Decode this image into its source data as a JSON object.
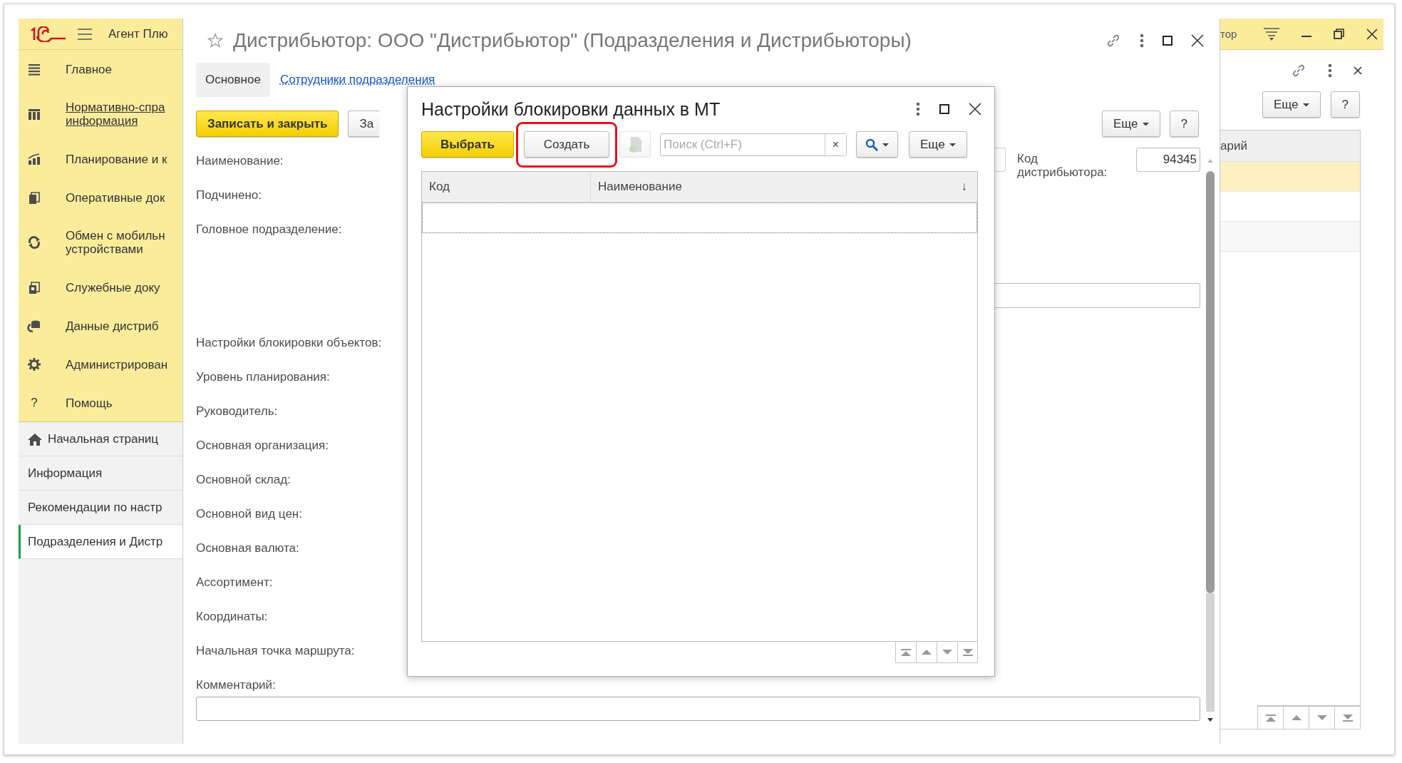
{
  "sidebar": {
    "app_title": "Агент Плю",
    "sections": [
      {
        "label": "Главное",
        "underlined": false
      },
      {
        "label": "Нормативно-спра\nинформация",
        "underlined": true
      },
      {
        "label": "Планирование и к",
        "underlined": false
      },
      {
        "label": "Оперативные док",
        "underlined": false
      },
      {
        "label": "Обмен с мобильн\nустройствами",
        "underlined": false
      },
      {
        "label": "Служебные доку",
        "underlined": false
      },
      {
        "label": "Данные дистриб",
        "underlined": false
      },
      {
        "label": "Администрирован",
        "underlined": false
      },
      {
        "label": "Помощь",
        "underlined": false,
        "glyph": "?"
      }
    ],
    "open_windows": [
      {
        "label": "Начальная страниц",
        "selected": false
      },
      {
        "label": "Информация",
        "selected": false
      },
      {
        "label": "Рекомендации по настр",
        "selected": false
      },
      {
        "label": "Подразделения и Дистр",
        "selected": true
      }
    ]
  },
  "main_form": {
    "title": "Дистрибьютор: ООО \"Дистрибьютор\" (Подразделения и Дистрибьюторы)",
    "tabs": [
      {
        "label": "Основное",
        "selected": true
      },
      {
        "label": "Сотрудники подразделения",
        "selected": false
      }
    ],
    "buttons": [
      {
        "label": "Записать и закрыть",
        "default": true
      },
      {
        "label": "За",
        "default": false
      }
    ],
    "right_buttons": [
      "Еще",
      "?"
    ],
    "fields": [
      "Наименование:",
      "Подчинено:",
      "Головное подразделение:",
      "Настройки блокировки объектов:",
      "Уровень планирования:",
      "Руководитель:",
      "Основная организация:",
      "Основной склад:",
      "Основной вид цен:",
      "Основная валюта:",
      "Ассортимент:",
      "Координаты:",
      "Начальная точка маршрута:"
    ],
    "distributor_code": {
      "label": "Код\nдистрибьютора:",
      "value": "94345"
    },
    "comment": {
      "label": "Комментарий:"
    }
  },
  "dialog": {
    "title": "Настройки блокировки данных в МТ",
    "buttons": [
      {
        "label": "Выбрать",
        "default": true,
        "highlighted": false
      },
      {
        "label": "Создать",
        "default": false,
        "highlighted": true
      }
    ],
    "copy_button": {
      "disabled": true
    },
    "search": {
      "placeholder": "Поиск (Ctrl+F)",
      "clear": "×"
    },
    "more_button": "Еще",
    "table": {
      "columns": [
        {
          "label": "Код"
        },
        {
          "label": "Наименование",
          "sort": "↓"
        }
      ]
    }
  },
  "background_window": {
    "title": "тор",
    "buttons": [
      "Еще",
      "?"
    ],
    "table": {
      "columns": [
        "арий"
      ],
      "rows": [
        {
          "selected": true
        },
        {
          "selected": false
        },
        {
          "selected": false
        }
      ]
    }
  }
}
